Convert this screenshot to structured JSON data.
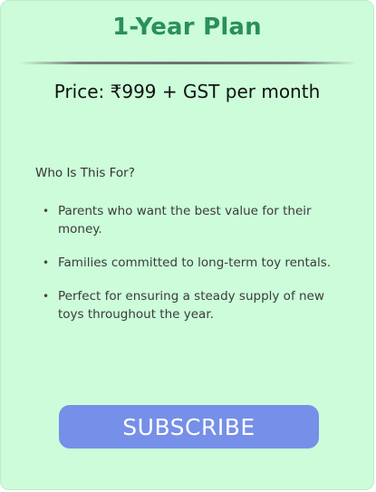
{
  "plan": {
    "title": "1-Year Plan",
    "price": "Price: ₹999 + GST per month"
  },
  "audience": {
    "heading": "Who Is This For?",
    "items": [
      "Parents who want the best value for their money.",
      "Families committed to long-term toy rentals.",
      "Perfect for ensuring a steady supply of new toys throughout the year."
    ]
  },
  "actions": {
    "subscribe_label": "SUBSCRIBE"
  },
  "colors": {
    "card_bg": "#ccfcd9",
    "title": "#2a8f5b",
    "button": "#768fe8"
  }
}
